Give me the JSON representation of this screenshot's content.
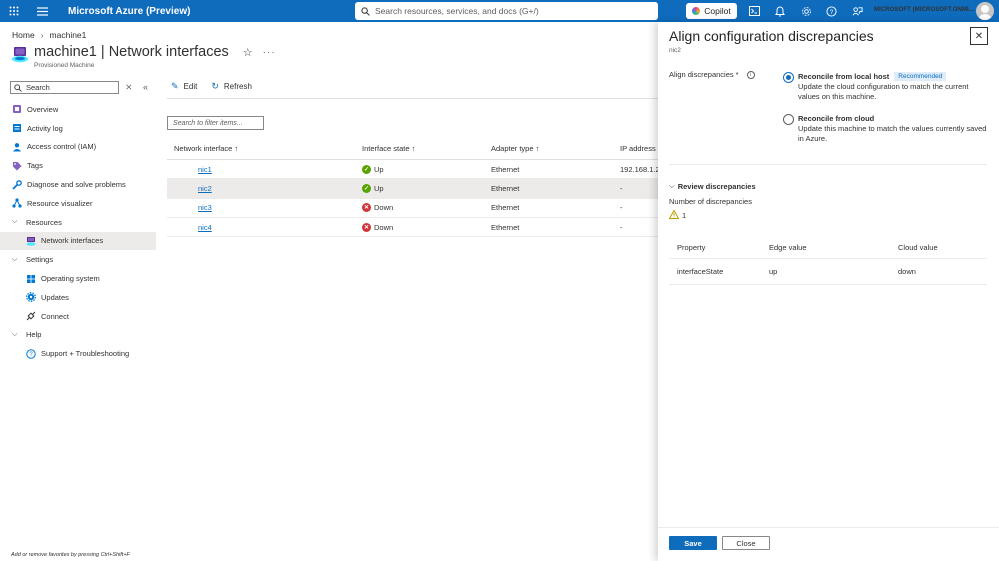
{
  "topbar": {
    "brand": "Microsoft Azure (Preview)",
    "search_placeholder": "Search resources, services, and docs (G+/)",
    "copilot_label": "Copilot",
    "account": "MICROSOFT (MICROSOFT.ONMI..."
  },
  "breadcrumb": [
    "Home",
    "machine1"
  ],
  "resource": {
    "title": "machine1 | Network interfaces",
    "subtitle": "Provisioned Machine"
  },
  "nav": {
    "search_placeholder": "Search",
    "items": [
      {
        "label": "Overview"
      },
      {
        "label": "Activity log"
      },
      {
        "label": "Access control (IAM)"
      },
      {
        "label": "Tags"
      },
      {
        "label": "Diagnose and solve problems"
      },
      {
        "label": "Resource visualizer"
      },
      {
        "label": "Resources"
      },
      {
        "label": "Network interfaces"
      },
      {
        "label": "Settings"
      },
      {
        "label": "Operating system"
      },
      {
        "label": "Updates"
      },
      {
        "label": "Connect"
      },
      {
        "label": "Help"
      },
      {
        "label": "Support + Troubleshooting"
      }
    ],
    "favorites_hint": "Add or remove favorites by pressing Ctrl+Shift+F"
  },
  "toolbar": {
    "edit_label": "Edit",
    "refresh_label": "Refresh"
  },
  "filter_placeholder": "Search to filter items...",
  "grid": {
    "columns": [
      "Network interface ↑",
      "Interface state ↑",
      "Adapter type ↑",
      "IP address"
    ],
    "rows": [
      {
        "name": "nic1",
        "state": "Up",
        "adapter": "Ethernet",
        "ip": "192.168.1.2"
      },
      {
        "name": "nic2",
        "state": "Up",
        "adapter": "Ethernet",
        "ip": "-"
      },
      {
        "name": "nic3",
        "state": "Down",
        "adapter": "Ethernet",
        "ip": "-"
      },
      {
        "name": "nic4",
        "state": "Down",
        "adapter": "Ethernet",
        "ip": "-"
      }
    ]
  },
  "panel": {
    "title": "Align configuration discrepancies",
    "subtitle": "nic2",
    "align_label": "Align discrepancies",
    "required_marker": "*",
    "option1_title": "Reconcile from local host",
    "option1_badge": "Recommended",
    "option1_desc": "Update the cloud configuration to match the current values on this machine.",
    "option2_title": "Reconcile from cloud",
    "option2_desc": "Update this machine to match the values currently saved in Azure.",
    "review_label": "Review discrepancies",
    "num_label": "Number of discrepancies",
    "num_value": "1",
    "table_headers": [
      "Property",
      "Edge value",
      "Cloud value"
    ],
    "table_rows": [
      {
        "property": "interfaceState",
        "edge": "up",
        "cloud": "down"
      }
    ],
    "save_label": "Save",
    "close_label": "Close"
  }
}
